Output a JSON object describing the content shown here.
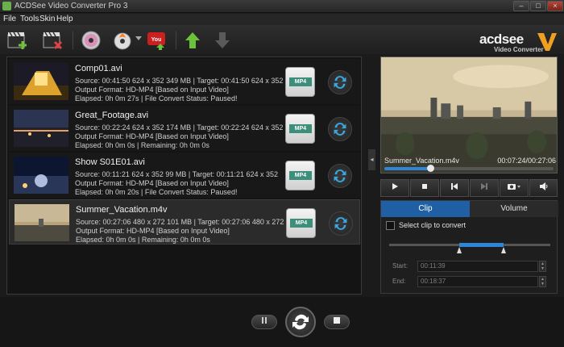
{
  "window": {
    "title": "ACDSee Video Converter Pro 3",
    "min": "–",
    "max": "□",
    "close": "×"
  },
  "menu": [
    "File",
    "Tools",
    "Skin",
    "Help"
  ],
  "brand": {
    "name": "acdsee",
    "sub": "Video Converter"
  },
  "files": [
    {
      "name": "Comp01.avi",
      "source": "Source: 00:41:50 624 x 352 349 MB | Target: 00:41:50 624 x 352",
      "format": "Output Format: HD-MP4 [Based on Input Video]",
      "status": "Elapsed: 0h 0m 27s | File Convert Status: Paused!",
      "badge": "MP4"
    },
    {
      "name": "Great_Footage.avi",
      "source": "Source: 00:22:24 624 x 352 174 MB | Target: 00:22:24 624 x 352",
      "format": "Output Format: HD-MP4 [Based on Input Video]",
      "status": "Elapsed: 0h 0m 0s | Remaining: 0h 0m 0s",
      "badge": "MP4"
    },
    {
      "name": "Show S01E01.avi",
      "source": "Source: 00:11:21 624 x 352 99 MB | Target: 00:11:21 624 x 352",
      "format": "Output Format: HD-MP4 [Based on Input Video]",
      "status": "Elapsed: 0h 0m 20s | File Convert Status: Paused!",
      "badge": "MP4"
    },
    {
      "name": "Summer_Vacation.m4v",
      "source": "Source: 00:27:06 480 x 272 101 MB | Target: 00:27:06 480 x 272",
      "format": "Output Format: HD-MP4 [Based on Input Video]",
      "status": "Elapsed: 0h 0m 0s | Remaining: 0h 0m 0s",
      "badge": "MP4"
    }
  ],
  "preview": {
    "file": "Summer_Vacation.m4v",
    "time": "00:07:24/00:27:06",
    "progress": 0.27
  },
  "tabs": {
    "clip": "Clip",
    "volume": "Volume"
  },
  "clip": {
    "select_label": "Select clip to convert",
    "start_label": "Start:",
    "start_value": "00:11:39",
    "end_label": "End:",
    "end_value": "00:18:37"
  },
  "colors": {
    "accent": "#2e86d6",
    "tab_active": "#1f5fa3"
  }
}
